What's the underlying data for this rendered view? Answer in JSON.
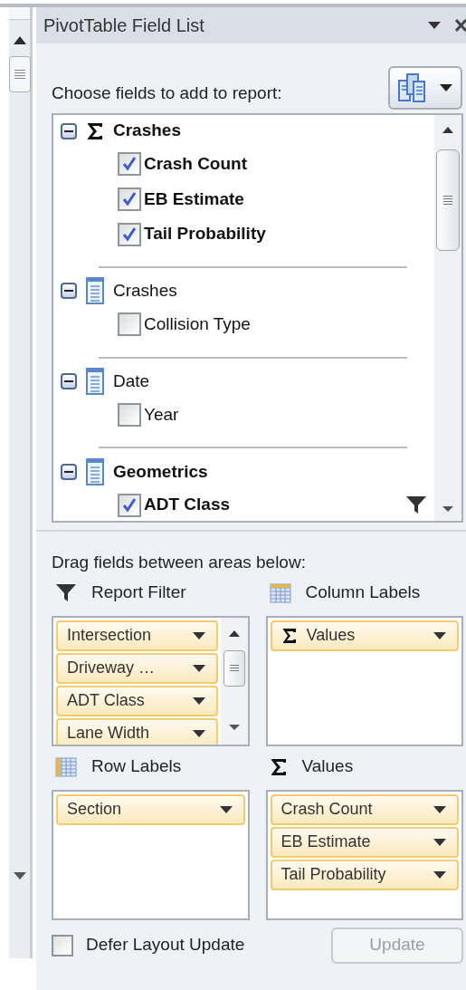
{
  "panel": {
    "title": "PivotTable Field List"
  },
  "chooser": {
    "label": "Choose fields to add to report:"
  },
  "field_groups": [
    {
      "kind": "measure",
      "name": "Crashes",
      "expanded": true,
      "fields": [
        {
          "label": "Crash Count",
          "checked": true
        },
        {
          "label": "EB Estimate",
          "checked": true
        },
        {
          "label": "Tail Probability",
          "checked": true
        }
      ]
    },
    {
      "kind": "table",
      "name": "Crashes",
      "expanded": true,
      "fields": [
        {
          "label": "Collision Type",
          "checked": false
        }
      ]
    },
    {
      "kind": "table",
      "name": "Date",
      "expanded": true,
      "fields": [
        {
          "label": "Year",
          "checked": false
        }
      ]
    },
    {
      "kind": "table",
      "name": "Geometrics",
      "expanded": true,
      "fields": [
        {
          "label": "ADT Class",
          "checked": true,
          "filtered": true
        }
      ]
    }
  ],
  "areas_label": "Drag fields between areas below:",
  "areas": [
    {
      "kind": "filter",
      "label": "Report Filter",
      "scrollable": true,
      "items": [
        {
          "label": "Intersection"
        },
        {
          "label": "Driveway …"
        },
        {
          "label": "ADT Class"
        },
        {
          "label": "Lane Width"
        }
      ]
    },
    {
      "kind": "columns",
      "label": "Column Labels",
      "scrollable": false,
      "items": [
        {
          "label": "Values",
          "sigma": true
        }
      ]
    },
    {
      "kind": "rows",
      "label": "Row Labels",
      "scrollable": false,
      "items": [
        {
          "label": "Section"
        }
      ]
    },
    {
      "kind": "values",
      "label": "Values",
      "scrollable": false,
      "items": [
        {
          "label": "Crash Count"
        },
        {
          "label": "EB Estimate"
        },
        {
          "label": "Tail Probability"
        }
      ]
    }
  ],
  "defer_layout": {
    "label": "Defer Layout Update",
    "checked": false
  },
  "update_button": {
    "label": "Update",
    "disabled": true
  }
}
